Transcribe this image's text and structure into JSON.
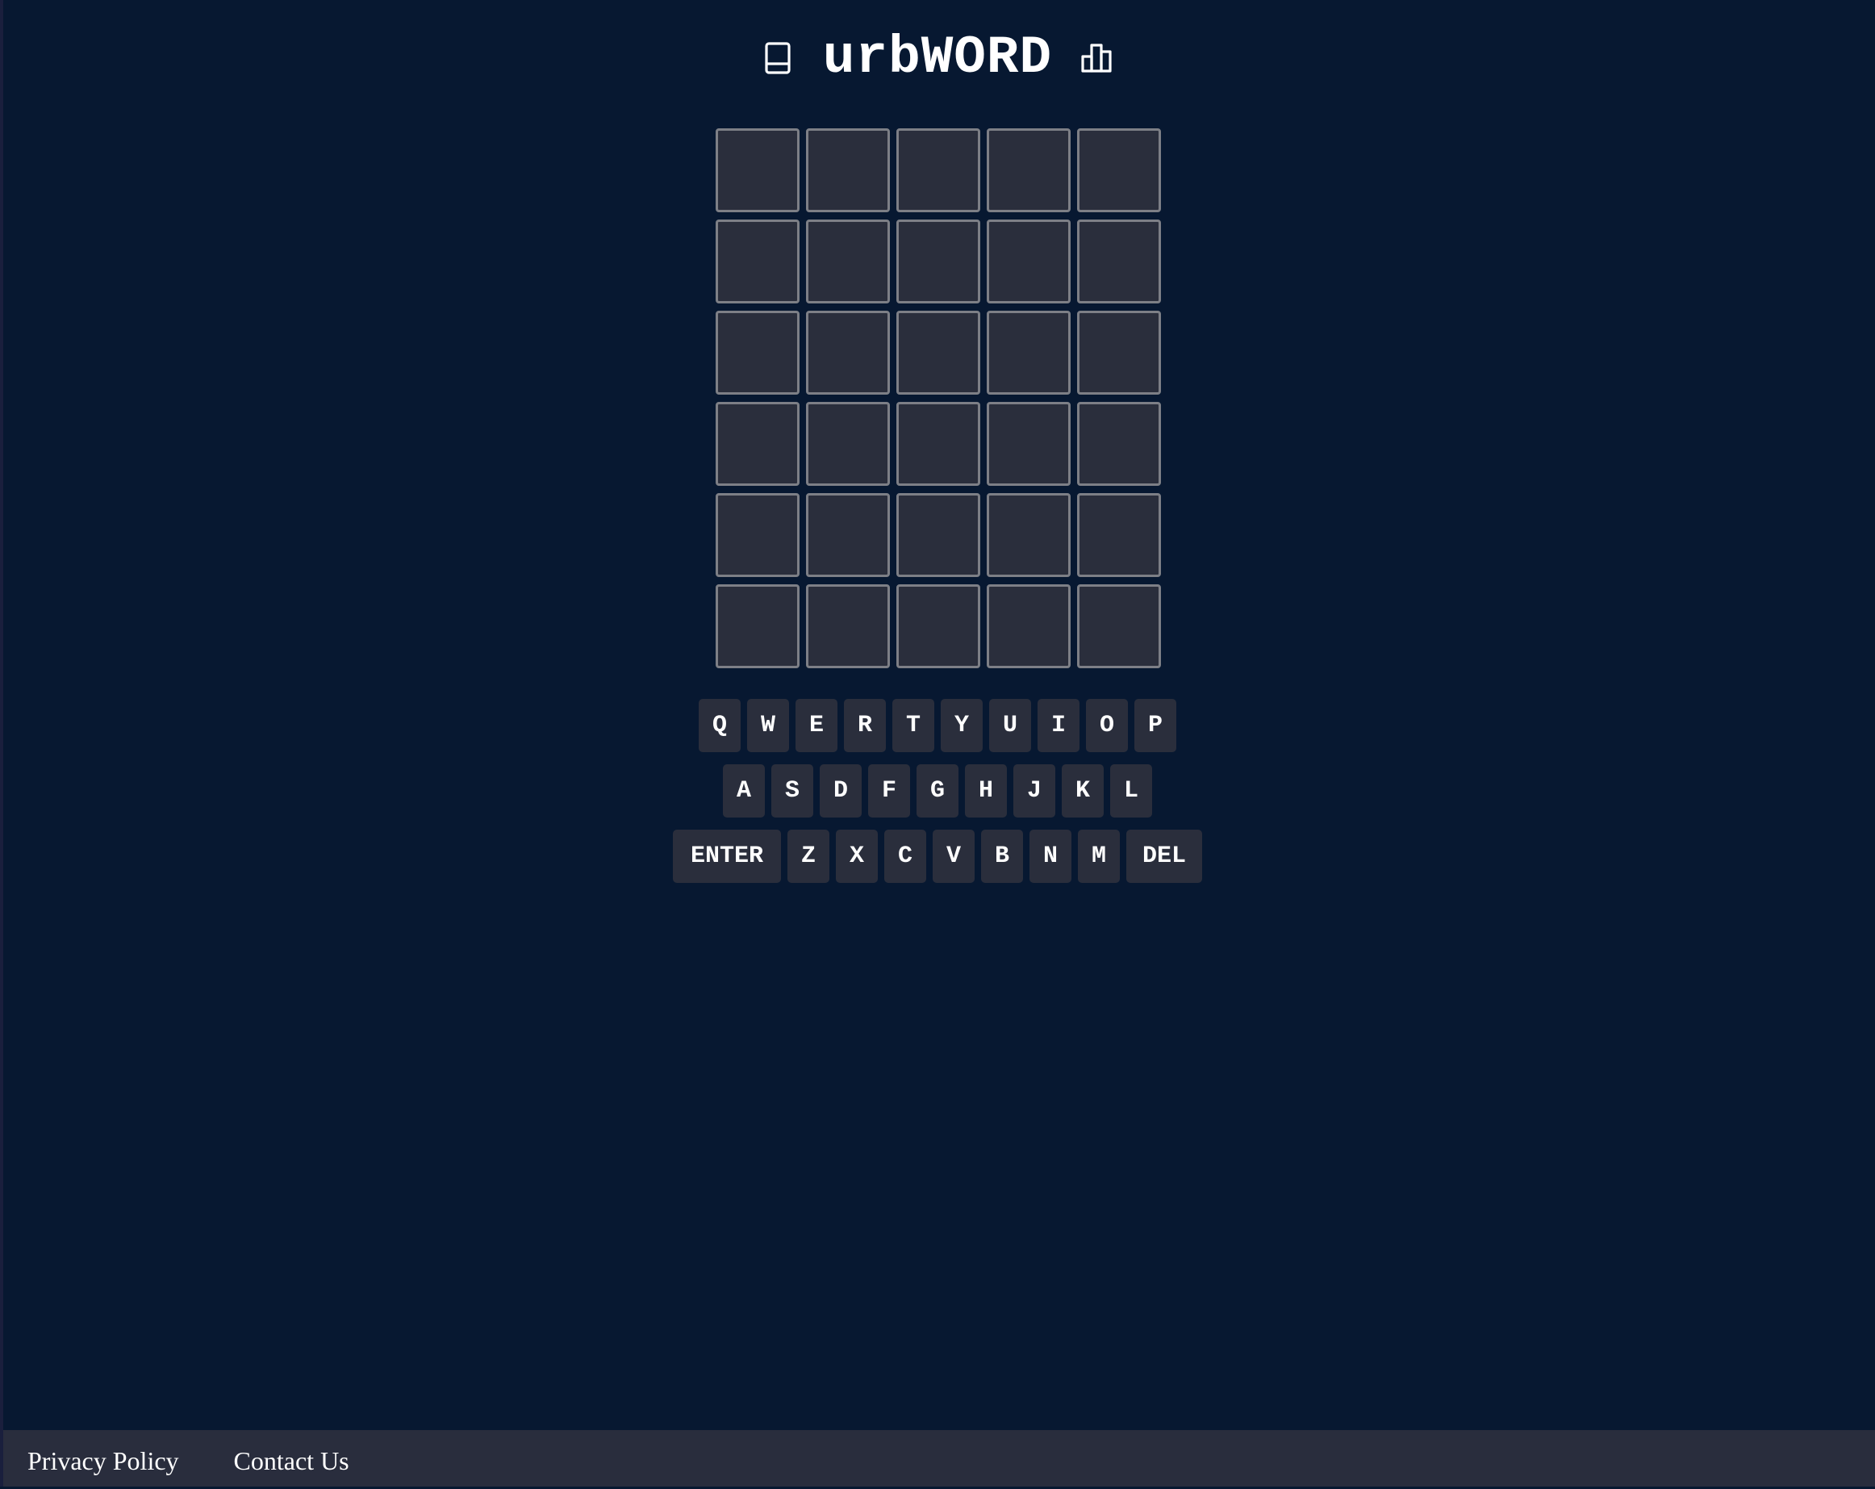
{
  "header": {
    "title": "urbWORD",
    "left_icon": "book-icon",
    "right_icon": "bar-chart-icon"
  },
  "board": {
    "rows": 6,
    "columns": 5,
    "tiles": [
      [
        "",
        "",
        "",
        "",
        ""
      ],
      [
        "",
        "",
        "",
        "",
        ""
      ],
      [
        "",
        "",
        "",
        "",
        ""
      ],
      [
        "",
        "",
        "",
        "",
        ""
      ],
      [
        "",
        "",
        "",
        "",
        ""
      ],
      [
        "",
        "",
        "",
        "",
        ""
      ]
    ]
  },
  "keyboard": {
    "row1": [
      "Q",
      "W",
      "E",
      "R",
      "T",
      "Y",
      "U",
      "I",
      "O",
      "P"
    ],
    "row2": [
      "A",
      "S",
      "D",
      "F",
      "G",
      "H",
      "J",
      "K",
      "L"
    ],
    "row3": [
      "ENTER",
      "Z",
      "X",
      "C",
      "V",
      "B",
      "N",
      "M",
      "DEL"
    ]
  },
  "footer": {
    "privacy_label": "Privacy Policy",
    "contact_label": "Contact Us"
  },
  "colors": {
    "background": "#071831",
    "tile": "#2a2e3c",
    "tile_border": "#7d7f86",
    "key": "#2a2e3c",
    "footer": "#292d3d",
    "text": "#ffffff"
  }
}
